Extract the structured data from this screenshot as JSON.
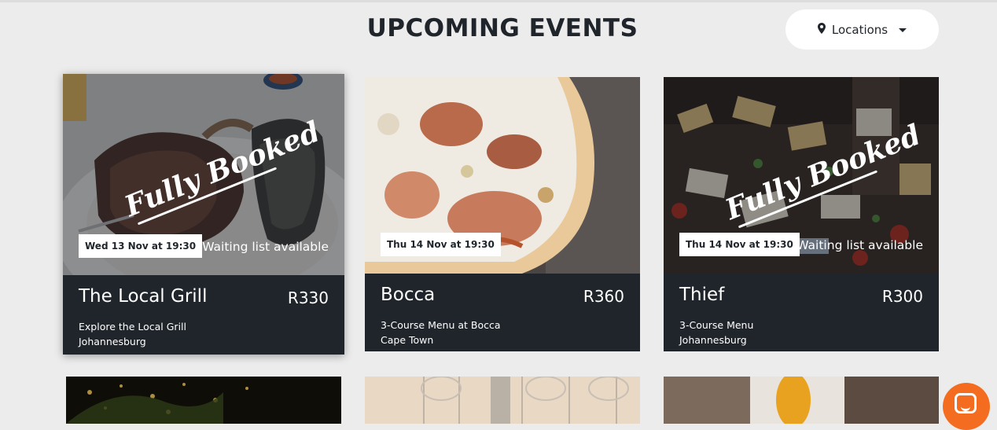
{
  "header": {
    "title": "UPCOMING EVENTS",
    "locations_label": "Locations"
  },
  "events": [
    {
      "name": "The Local Grill",
      "price": "R330",
      "description": "Explore the Local Grill",
      "city": "Johannesburg",
      "date": "Wed 13 Nov at 19:30",
      "status_overlay": "Fully Booked",
      "waiting_label": "Waiting list available"
    },
    {
      "name": "Bocca",
      "price": "R360",
      "description": "3-Course Menu at Bocca",
      "city": "Cape Town",
      "date": "Thu 14 Nov at 19:30"
    },
    {
      "name": "Thief",
      "price": "R300",
      "description": "3-Course Menu",
      "city": "Johannesburg",
      "date": "Thu 14 Nov at 19:30",
      "status_overlay": "Fully Booked",
      "waiting_label": "Waiting list available"
    }
  ],
  "icons": {
    "location": "map-pin-icon",
    "dropdown": "chevron-down-icon",
    "chat": "chat-bubble-icon"
  },
  "colors": {
    "background": "#ececec",
    "card_info": "#1f252b",
    "chat_accent": "#f46c1f"
  }
}
